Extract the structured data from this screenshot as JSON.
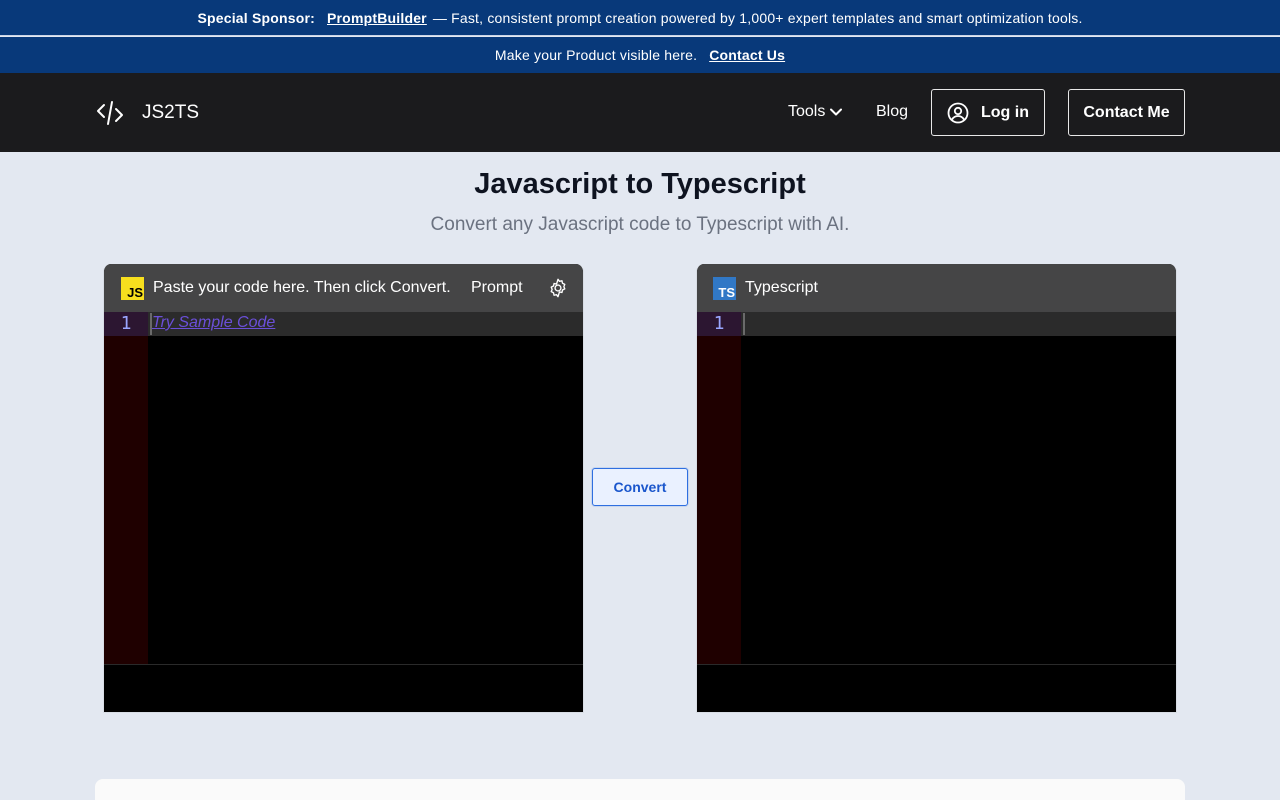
{
  "sponsor": {
    "label": "Special Sponsor:",
    "link": "PromptBuilder",
    "text": "— Fast, consistent prompt creation powered by 1,000+ expert templates and smart optimization tools."
  },
  "promo": {
    "text": "Make your Product visible here.",
    "link": "Contact Us"
  },
  "nav": {
    "brand": "JS2TS",
    "tools": "Tools",
    "blog": "Blog",
    "login": "Log in",
    "contact": "Contact Me"
  },
  "page": {
    "title": "Javascript to Typescript",
    "subtitle": "Convert any Javascript code to Typescript with AI."
  },
  "input_panel": {
    "badge": "JS",
    "label": "Paste your code here. Then click Convert.",
    "prompt": "Prompt",
    "line_number": "1",
    "sample_link": "Try Sample Code"
  },
  "output_panel": {
    "badge": "TS",
    "label": "Typescript",
    "line_number": "1"
  },
  "convert": {
    "label": "Convert"
  },
  "colors": {
    "banner": "#08397a",
    "navbar": "#1b1b1d",
    "background": "#e3e8f1",
    "js_badge": "#f7df1e",
    "ts_badge": "#3178c6",
    "convert_accent": "#2f6fe0"
  },
  "icons": [
    "code-icon",
    "chevron-down-icon",
    "user-circle-icon",
    "gear-icon"
  ]
}
